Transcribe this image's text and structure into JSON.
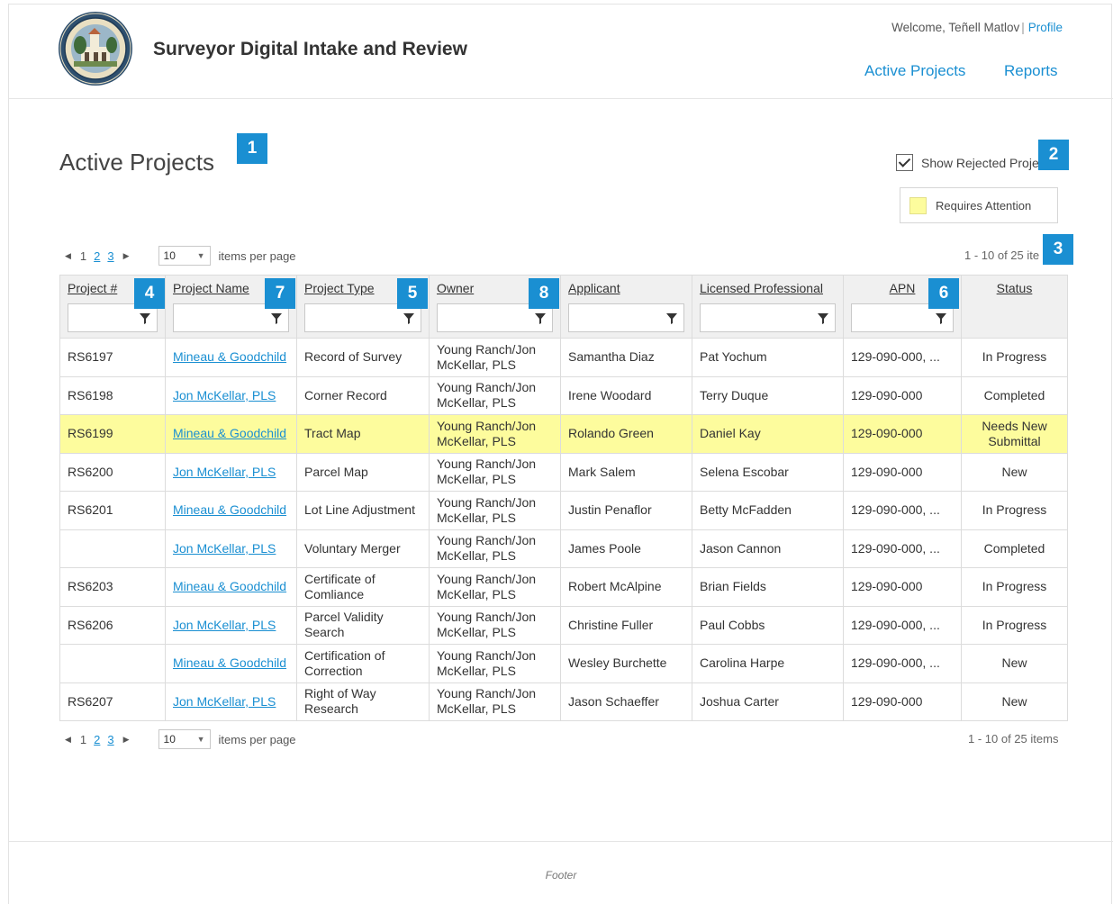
{
  "header": {
    "app_title": "Surveyor Digital Intake and Review",
    "welcome_text": "Welcome, Teñell Matlov",
    "separator": "|",
    "profile_link": "Profile",
    "nav": {
      "active_projects": "Active Projects",
      "reports": "Reports"
    }
  },
  "page": {
    "title": "Active Projects",
    "show_rejected_label": "Show Rejected Proje",
    "show_rejected_checked": true,
    "legend_label": "Requires Attention",
    "legend_color": "#fdfc9d",
    "accent_color": "#1a8fd2"
  },
  "badges": [
    "1",
    "2",
    "3",
    "4",
    "5",
    "6",
    "7",
    "8"
  ],
  "pager_top": {
    "pages": [
      "1",
      "2",
      "3"
    ],
    "page_size": "10",
    "items_per_page": "items per page",
    "count": "1 - 10 of 25 ite"
  },
  "pager_bottom": {
    "pages": [
      "1",
      "2",
      "3"
    ],
    "page_size": "10",
    "items_per_page": "items per page",
    "count": "1 - 10 of 25 items"
  },
  "columns": [
    "Project #",
    "Project Name",
    "Project Type",
    "Owner",
    "Applicant",
    "Licensed Professional",
    "APN",
    "Status"
  ],
  "rows": [
    {
      "id": "RS6197",
      "name": "Mineau & Goodchild",
      "type": "Record of Survey",
      "owner": "Young Ranch/Jon McKellar, PLS",
      "applicant": "Samantha Diaz",
      "professional": "Pat Yochum",
      "apn": "129-090-000, ...",
      "status": "In Progress",
      "highlight": false
    },
    {
      "id": "RS6198",
      "name": "Jon McKellar, PLS",
      "type": "Corner Record",
      "owner": "Young Ranch/Jon McKellar, PLS",
      "applicant": "Irene Woodard",
      "professional": "Terry Duque",
      "apn": "129-090-000",
      "status": "Completed",
      "highlight": false
    },
    {
      "id": "RS6199",
      "name": "Mineau & Goodchild",
      "type": "Tract Map",
      "owner": "Young Ranch/Jon McKellar, PLS",
      "applicant": "Rolando Green",
      "professional": "Daniel Kay",
      "apn": "129-090-000",
      "status": "Needs New Submittal",
      "highlight": true
    },
    {
      "id": "RS6200",
      "name": "Jon McKellar, PLS",
      "type": "Parcel Map",
      "owner": "Young Ranch/Jon McKellar, PLS",
      "applicant": "Mark Salem",
      "professional": "Selena Escobar",
      "apn": "129-090-000",
      "status": "New",
      "highlight": false
    },
    {
      "id": "RS6201",
      "name": "Mineau & Goodchild",
      "type": "Lot Line Adjustment",
      "owner": "Young Ranch/Jon McKellar, PLS",
      "applicant": "Justin Penaflor",
      "professional": "Betty McFadden",
      "apn": "129-090-000, ...",
      "status": "In Progress",
      "highlight": false
    },
    {
      "id": "",
      "name": "Jon McKellar, PLS",
      "type": "Voluntary Merger",
      "owner": "Young Ranch/Jon McKellar, PLS",
      "applicant": "James Poole",
      "professional": "Jason Cannon",
      "apn": "129-090-000, ...",
      "status": "Completed",
      "highlight": false
    },
    {
      "id": "RS6203",
      "name": "Mineau & Goodchild",
      "type": "Certificate of Comliance",
      "owner": "Young Ranch/Jon McKellar, PLS",
      "applicant": "Robert McAlpine",
      "professional": "Brian Fields",
      "apn": "129-090-000",
      "status": "In Progress",
      "highlight": false
    },
    {
      "id": "RS6206",
      "name": "Jon McKellar, PLS",
      "type": "Parcel Validity Search",
      "owner": "Young Ranch/Jon McKellar, PLS",
      "applicant": "Christine Fuller",
      "professional": "Paul Cobbs",
      "apn": "129-090-000, ...",
      "status": "In Progress",
      "highlight": false
    },
    {
      "id": "",
      "name": "Mineau & Goodchild",
      "type": "Certification of Correction",
      "owner": "Young Ranch/Jon McKellar, PLS",
      "applicant": "Wesley Burchette",
      "professional": "Carolina Harpe",
      "apn": "129-090-000, ...",
      "status": "New",
      "highlight": false
    },
    {
      "id": "RS6207",
      "name": "Jon McKellar, PLS",
      "type": "Right of Way Research",
      "owner": "Young Ranch/Jon McKellar, PLS",
      "applicant": "Jason Schaeffer",
      "professional": "Joshua Carter",
      "apn": "129-090-000",
      "status": "New",
      "highlight": false
    }
  ],
  "footer": {
    "text": "Footer"
  },
  "icons": {
    "seal": "county-seal-icon",
    "filter": "funnel-icon",
    "checkbox": "checkmark-icon"
  }
}
